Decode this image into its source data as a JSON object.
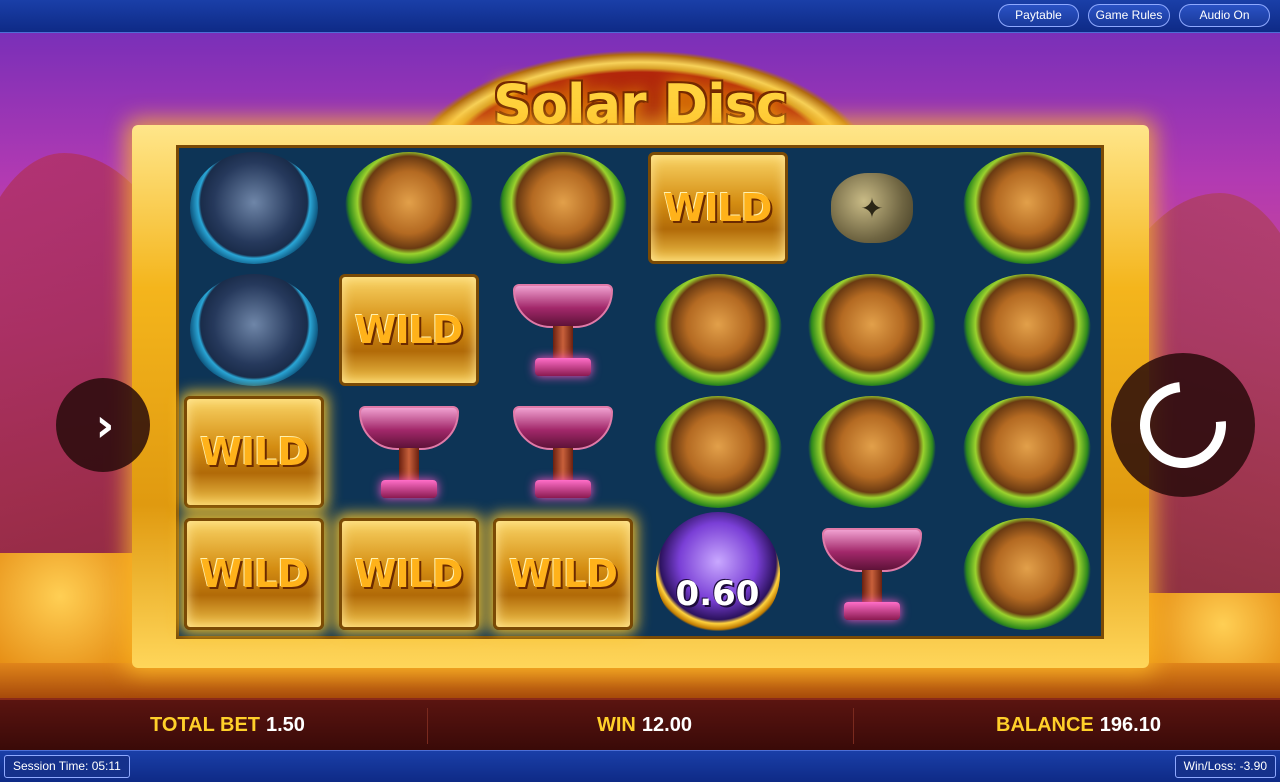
{
  "top_nav": {
    "paytable": "Paytable",
    "game_rules": "Game Rules",
    "audio": "Audio On"
  },
  "game": {
    "title": "Solar Disc",
    "colors": {
      "gold": "#ffd23d",
      "frame": "#f4b51c",
      "reel_bg": "#0d3456"
    }
  },
  "reels": [
    [
      "bear",
      "bear",
      "wild",
      "wild"
    ],
    [
      "puma",
      "wild",
      "goblet",
      "wild"
    ],
    [
      "puma",
      "goblet",
      "goblet",
      "wild"
    ],
    [
      "wild",
      "puma",
      "puma",
      "coin"
    ],
    [
      "disc",
      "puma",
      "puma",
      "goblet"
    ],
    [
      "puma",
      "puma",
      "puma",
      "puma"
    ]
  ],
  "symbols": {
    "wild_label": "WILD",
    "coin_value": "0.60"
  },
  "controls": {
    "side_arrow_icon": "chevron-right-icon",
    "spin_icon": "refresh-icon"
  },
  "status": {
    "total_bet_label": "TOTAL BET",
    "total_bet_value": "1.50",
    "win_label": "WIN",
    "win_value": "12.00",
    "balance_label": "BALANCE",
    "balance_value": "196.10"
  },
  "footer": {
    "session_time": "Session Time:  05:11",
    "win_loss": "Win/Loss:  -3.90"
  }
}
